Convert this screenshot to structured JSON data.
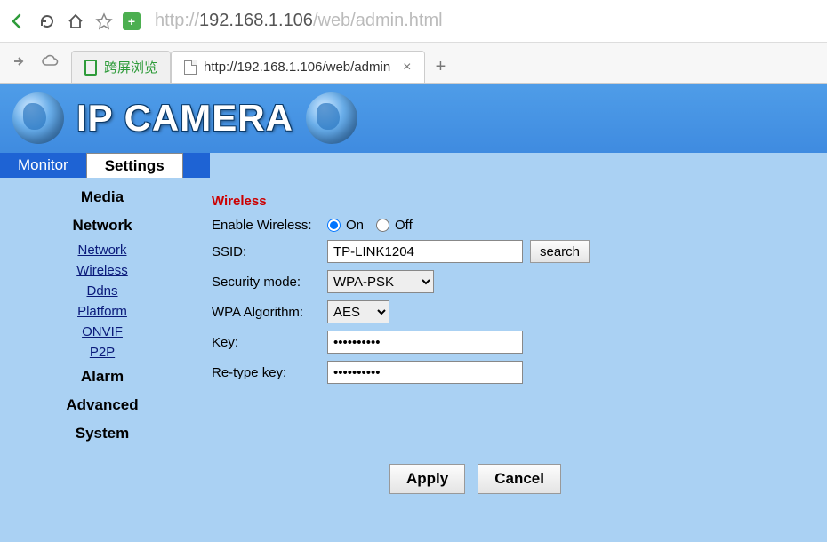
{
  "browser": {
    "url_prefix": "http://",
    "url_host": "192.168.1.106",
    "url_path": "/web/admin.html"
  },
  "tabs": {
    "tab1_label": "跨屏浏览",
    "tab2_label": "http://192.168.1.106/web/admin"
  },
  "header": {
    "logo_text": "IP CAMERA"
  },
  "topnav": {
    "monitor": "Monitor",
    "settings": "Settings"
  },
  "sidebar": {
    "media": "Media",
    "network": "Network",
    "network_items": {
      "network": "Network",
      "wireless": "Wireless",
      "ddns": "Ddns",
      "platform": "Platform",
      "onvif": "ONVIF",
      "p2p": "P2P"
    },
    "alarm": "Alarm",
    "advanced": "Advanced",
    "system": "System"
  },
  "form": {
    "section_title": "Wireless",
    "enable_label": "Enable Wireless:",
    "on_label": "On",
    "off_label": "Off",
    "ssid_label": "SSID:",
    "ssid_value": "TP-LINK1204",
    "search_btn": "search",
    "secmode_label": "Security mode:",
    "secmode_value": "WPA-PSK",
    "algo_label": "WPA Algorithm:",
    "algo_value": "AES",
    "key_label": "Key:",
    "key_value": "••••••••••",
    "rekey_label": "Re-type key:",
    "rekey_value": "••••••••••",
    "apply": "Apply",
    "cancel": "Cancel"
  }
}
